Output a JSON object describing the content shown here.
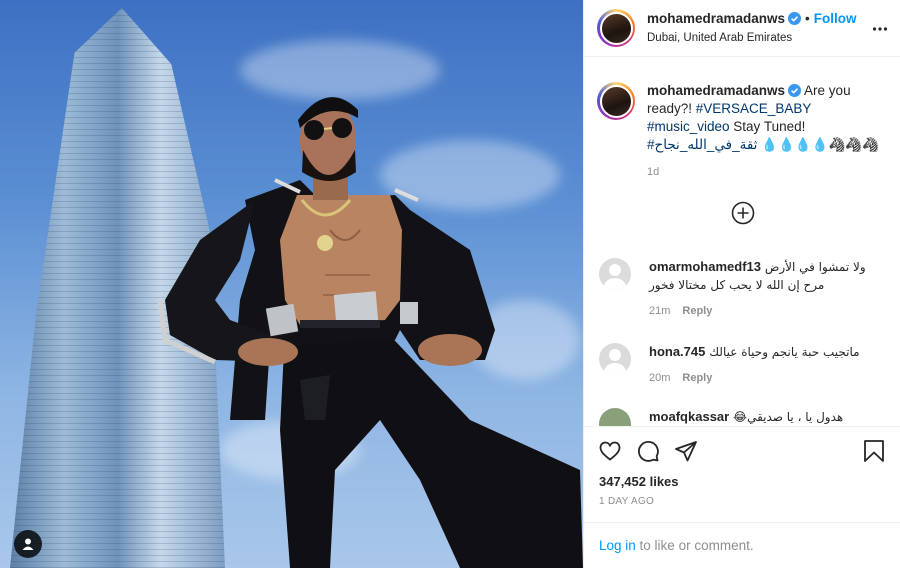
{
  "post": {
    "photo": {
      "description_icon": "user-tag-icon"
    },
    "header": {
      "username": "mohamedramadanws",
      "separator": "•",
      "follow_label": "Follow",
      "location": "Dubai, United Arab Emirates"
    },
    "caption": {
      "username": "mohamedramadanws",
      "text_1": " Are you ready?! ",
      "hashtag_1": "#VERSACE_BABY",
      "hashtag_2": "#music_video",
      "text_2": " Stay Tuned!",
      "hashtag_3": "#ثقة_في_الله_نجاح",
      "emojis": " 💧💧💧💧🦓🦓🦓",
      "time": "1d"
    },
    "comments": [
      {
        "username": "omarmohamedf13",
        "text": " ولا تمشوا في الأرض مرح إن الله لا يحب كل مختالا فخور",
        "time": "21m",
        "reply": "Reply"
      },
      {
        "username": "hona.745",
        "text": " ماتجيب حبة يانجم وحياة عيالك",
        "time": "20m",
        "reply": "Reply"
      },
      {
        "username": "moafqkassar",
        "text": " 😂هدول يا ، يا صديقي",
        "time": "",
        "reply": ""
      }
    ],
    "likes": "347,452 likes",
    "time_ago": "1 DAY AGO",
    "login": {
      "link": "Log in",
      "text": " to like or comment."
    }
  },
  "colors": {
    "accent": "#0095f6",
    "hashtag": "#00376b",
    "muted": "#8e8e8e",
    "border": "#efefef"
  }
}
